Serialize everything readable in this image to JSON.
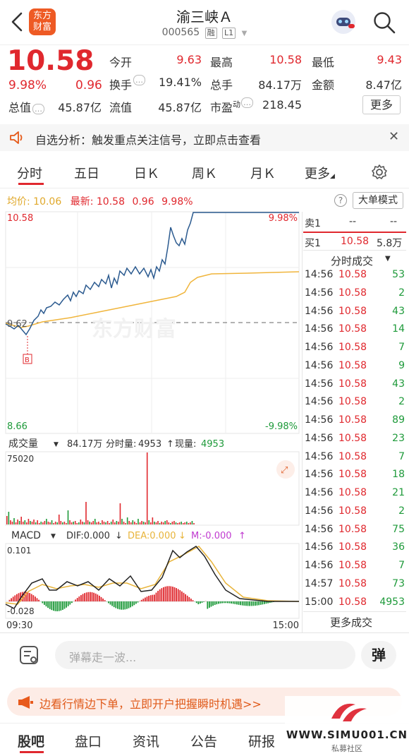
{
  "header": {
    "title": "渝三峡Ａ",
    "code": "000565",
    "tag_margin": "融",
    "tag_level": "L1",
    "logo_line1": "东方",
    "logo_line2": "财富"
  },
  "quote": {
    "price": "10.58",
    "change_pct": "9.98%",
    "change": "0.96",
    "open_label": "今开",
    "open": "9.63",
    "high_label": "最高",
    "high": "10.58",
    "low_label": "最低",
    "low": "9.43",
    "turnover_label": "换手",
    "turnover": "19.41%",
    "volume_label": "总手",
    "volume": "84.17万",
    "amount_label": "金额",
    "amount": "8.47亿",
    "mktcap_label": "总值",
    "mktcap": "45.87亿",
    "float_label": "流值",
    "float": "45.87亿",
    "pe_label": "市盈",
    "pe_sup": "动",
    "pe": "218.45",
    "more_label": "更多"
  },
  "notice": {
    "text": "自选分析：触发重点关注信号，立即点击查看"
  },
  "tabs": [
    "分时",
    "五日",
    "日Ｋ",
    "周Ｋ",
    "月Ｋ",
    "更多"
  ],
  "chart_info": {
    "avg_label": "均价:",
    "avg": "10.06",
    "latest_label": "最新:",
    "latest": "10.58",
    "latest_change": "0.96",
    "latest_pct": "9.98%",
    "mode_button": "大单模式",
    "y_top": "10.58",
    "y_mid": "9.62",
    "y_bottom": "8.66",
    "pct_top": "9.98%",
    "pct_bottom": "-9.98%",
    "marker": "B",
    "watermark": "东方财富"
  },
  "volume_bar": {
    "label": "成交量",
    "total": "84.17万",
    "period_label": "分时量:",
    "period": "4953",
    "now_label": "现量:",
    "now": "4953",
    "y_max": "75020"
  },
  "macd_bar": {
    "label": "MACD",
    "dif": "DIF:0.000",
    "dea": "DEA:0.000",
    "m": "M:-0.000",
    "y_top": "0.101",
    "y_bottom": "-0.028",
    "time_start": "09:30",
    "time_end": "15:00"
  },
  "order_book": {
    "sell1_label": "卖1",
    "sell1_price": "--",
    "sell1_vol": "--",
    "buy1_label": "买1",
    "buy1_price": "10.58",
    "buy1_vol": "5.8万",
    "trades_title": "分时成交",
    "more_trades": "更多成交"
  },
  "trades": [
    {
      "time": "14:56",
      "price": "10.58",
      "vol": "53"
    },
    {
      "time": "14:56",
      "price": "10.58",
      "vol": "2"
    },
    {
      "time": "14:56",
      "price": "10.58",
      "vol": "43"
    },
    {
      "time": "14:56",
      "price": "10.58",
      "vol": "14"
    },
    {
      "time": "14:56",
      "price": "10.58",
      "vol": "7"
    },
    {
      "time": "14:56",
      "price": "10.58",
      "vol": "9"
    },
    {
      "time": "14:56",
      "price": "10.58",
      "vol": "43"
    },
    {
      "time": "14:56",
      "price": "10.58",
      "vol": "2"
    },
    {
      "time": "14:56",
      "price": "10.58",
      "vol": "89"
    },
    {
      "time": "14:56",
      "price": "10.58",
      "vol": "23"
    },
    {
      "time": "14:56",
      "price": "10.58",
      "vol": "7"
    },
    {
      "time": "14:56",
      "price": "10.58",
      "vol": "18"
    },
    {
      "time": "14:56",
      "price": "10.58",
      "vol": "21"
    },
    {
      "time": "14:56",
      "price": "10.58",
      "vol": "2"
    },
    {
      "time": "14:56",
      "price": "10.58",
      "vol": "75"
    },
    {
      "time": "14:56",
      "price": "10.58",
      "vol": "36"
    },
    {
      "time": "14:56",
      "price": "10.58",
      "vol": "7"
    },
    {
      "time": "14:57",
      "price": "10.58",
      "vol": "73"
    },
    {
      "time": "15:00",
      "price": "10.58",
      "vol": "4953"
    }
  ],
  "bottom": {
    "danmu_placeholder": "弹幕走一波...",
    "danmu_button": "弹",
    "promo": "边看行情边下单，立即开户把握瞬时机遇>>",
    "tabs": [
      "股吧",
      "盘口",
      "资讯",
      "公告",
      "研报"
    ],
    "wm_site": "WWW.SIMU001.CN",
    "wm_sub": "私募社区"
  },
  "colors": {
    "up": "#e0282e",
    "down": "#1e9a3a",
    "price_line": "#2b5a8f",
    "avg_line": "#f0b53c",
    "macd_dea": "#e8b43a"
  }
}
